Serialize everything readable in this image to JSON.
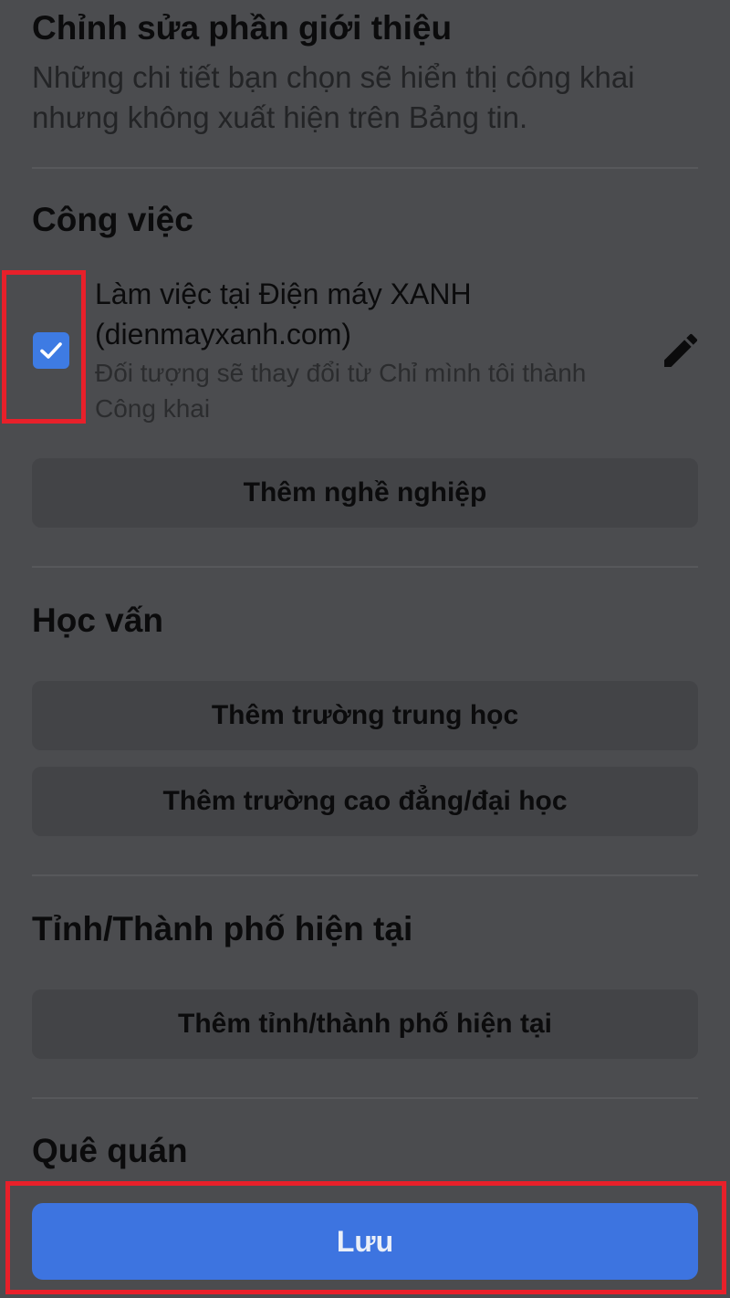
{
  "header": {
    "title": "Chỉnh sửa phần giới thiệu",
    "subtitle": "Những chi tiết bạn chọn sẽ hiển thị công khai nhưng không xuất hiện trên Bảng tin."
  },
  "work": {
    "section_title": "Công việc",
    "item_title": "Làm việc tại Điện máy XANH (dienmayxanh.com)",
    "item_note": "Đối tượng sẽ thay đổi từ Chỉ mình tôi thành Công khai",
    "checked": true,
    "add_button": "Thêm nghề nghiệp",
    "icons": {
      "checkbox": "check-icon",
      "edit": "pencil-icon"
    }
  },
  "education": {
    "section_title": "Học vấn",
    "add_high_school": "Thêm trường trung học",
    "add_college": "Thêm trường cao đẳng/đại học"
  },
  "current_city": {
    "section_title": "Tỉnh/Thành phố hiện tại",
    "add_button": "Thêm tỉnh/thành phố hiện tại"
  },
  "hometown": {
    "section_title": "Quê quán"
  },
  "footer": {
    "save_label": "Lưu"
  },
  "colors": {
    "background": "#4b4c4f",
    "button_bg": "#434447",
    "accent": "#3d74e0",
    "highlight": "#e8202a"
  }
}
